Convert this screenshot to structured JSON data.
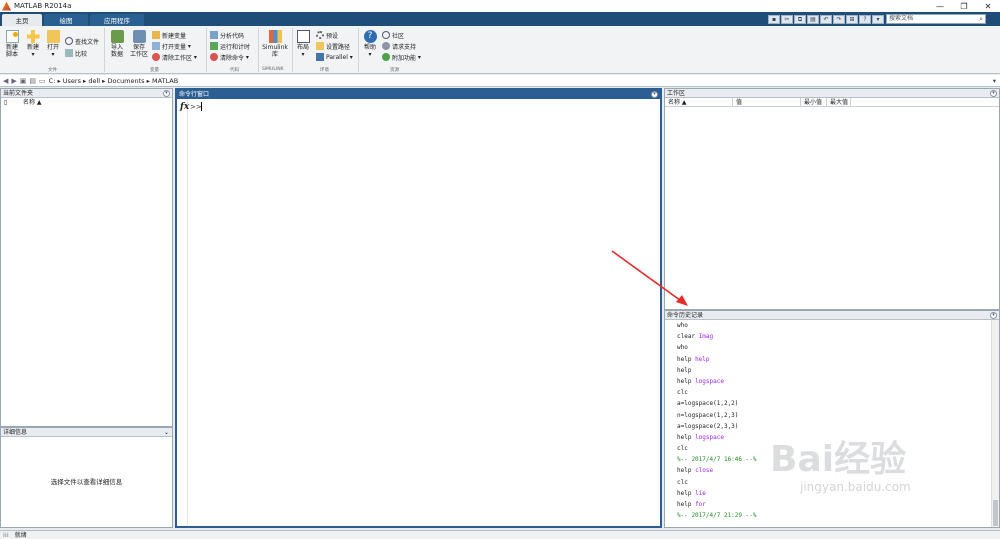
{
  "window": {
    "title": "MATLAB R2014a"
  },
  "tabs": [
    {
      "label": "主页"
    },
    {
      "label": "绘图"
    },
    {
      "label": "应用程序"
    }
  ],
  "search": {
    "placeholder": "搜索文档"
  },
  "ribbon": {
    "new_script": "新建\n脚本",
    "new": "新建",
    "open": "打开",
    "find_files": "查找文件",
    "compare": "比较",
    "import_data": "导入\n数据",
    "save_workspace": "保存\n工作区",
    "new_variable": "新建变量",
    "open_variable": "打开变量",
    "clear_workspace": "清除工作区",
    "analyze_code": "分析代码",
    "run_and_time": "运行和计时",
    "clear_commands": "清除命令",
    "simulink": "Simulink\n库",
    "layout": "布局",
    "preferences": "预设",
    "set_path": "设置路径",
    "parallel": "Parallel",
    "help": "帮助",
    "community": "社区",
    "request_support": "请求支持",
    "addons": "附加功能",
    "groups": {
      "file": "文件",
      "variable": "变量",
      "code": "代码",
      "simulink": "SIMULINK",
      "environment": "环境",
      "resources": "资源"
    }
  },
  "address": {
    "path": "C: ▸ Users ▸ dell ▸ Documents ▸ MATLAB"
  },
  "current_folder": {
    "title": "当前文件夹",
    "column": "名称 ▲"
  },
  "details": {
    "title": "详细信息",
    "hint": "选择文件以查看详细信息"
  },
  "command_window": {
    "title": "命令行窗口",
    "fx": "fx",
    "prompt": ">>"
  },
  "workspace": {
    "title": "工作区",
    "columns": [
      "名称 ▲",
      "值",
      "最小值",
      "最大值"
    ]
  },
  "history": {
    "title": "命令历史记录",
    "lines": [
      {
        "text": "who"
      },
      {
        "text": "clear ",
        "kw": "Imag"
      },
      {
        "text": "who"
      },
      {
        "text": "help ",
        "kw": "help"
      },
      {
        "text": "help"
      },
      {
        "text": "help ",
        "kw": "logspace"
      },
      {
        "text": "clc"
      },
      {
        "text": "a=logspace(1,2,2)"
      },
      {
        "text": "n=logspace(1,2,3)"
      },
      {
        "text": "a=logspace(2,3,3)"
      },
      {
        "text": "help ",
        "kw": "logspace"
      },
      {
        "text": "clc"
      },
      {
        "ts": "%-- 2017/4/7 16:46 --%"
      },
      {
        "text": "help ",
        "kw": "close"
      },
      {
        "text": "clc"
      },
      {
        "text": "help ",
        "kw": "lie"
      },
      {
        "text": "help ",
        "kw": "for"
      },
      {
        "ts": "%-- 2017/4/7 21:29 --%"
      }
    ]
  },
  "status": {
    "text": "就绪"
  },
  "watermark": {
    "brand": "Bai经验",
    "url": "jingyan.baidu.com"
  }
}
